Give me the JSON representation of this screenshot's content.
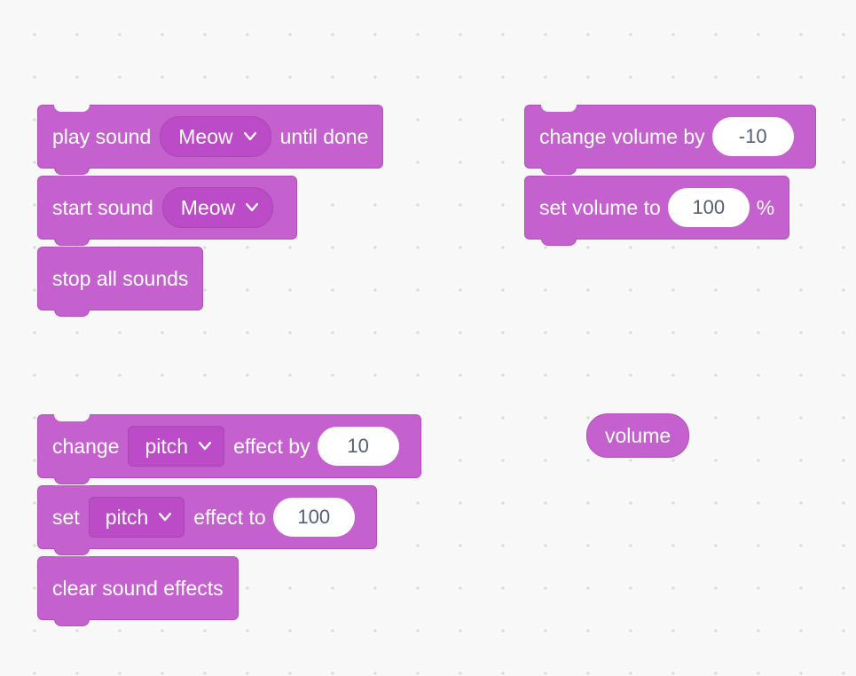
{
  "colors": {
    "block_fill": "#c561cf",
    "block_border": "#b14fbd",
    "dropdown_fill": "#bb4bc7",
    "input_text": "#575e74",
    "page_bg": "#f8f8f8"
  },
  "stack1": {
    "block1": {
      "prefix": "play sound",
      "dropdown": "Meow",
      "suffix": "until done"
    },
    "block2": {
      "prefix": "start sound",
      "dropdown": "Meow"
    },
    "block3": {
      "label": "stop all sounds"
    }
  },
  "stack2": {
    "block1": {
      "prefix": "change volume by",
      "value": "-10"
    },
    "block2": {
      "prefix": "set volume to",
      "value": "100",
      "suffix": "%"
    }
  },
  "stack3": {
    "block1": {
      "prefix": "change",
      "dropdown": "pitch",
      "mid": "effect by",
      "value": "10"
    },
    "block2": {
      "prefix": "set",
      "dropdown": "pitch",
      "mid": "effect to",
      "value": "100"
    },
    "block3": {
      "label": "clear sound effects"
    }
  },
  "reporter": {
    "label": "volume"
  }
}
